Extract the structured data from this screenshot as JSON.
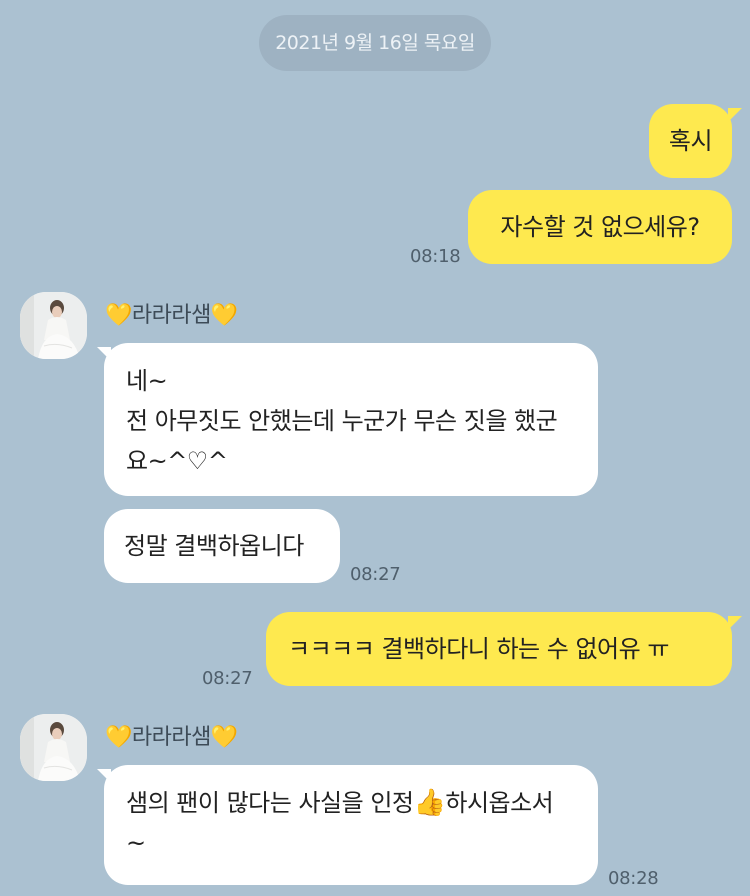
{
  "date_label": "2021년 9월 16일 목요일",
  "contact_name": "라라라샘",
  "heart_emoji": "💛",
  "thumbs_emoji": "👍",
  "messages": {
    "m1": "혹시",
    "m2": "자수할 것 없으세유?",
    "m2_time": "08:18",
    "m3_line1": "네~",
    "m3_line2": "전  아무짓도 안했는데 누군가 무슨 짓을 했군",
    "m3_line3": "요~^♡^",
    "m4": "정말 결백하옵니다",
    "m4_time": "08:27",
    "m5": "ㅋㅋㅋㅋ 결백하다니 하는 수 없어유 ㅠ",
    "m5_time": "08:27",
    "m6_part1": "샘의 팬이 많다는 사실을 인정",
    "m6_part2": "하시옵소서",
    "m6_line2": "~",
    "m6_time": "08:28"
  },
  "colors": {
    "background": "#abc1d1",
    "my_bubble": "#fee94f",
    "other_bubble": "#ffffff"
  }
}
